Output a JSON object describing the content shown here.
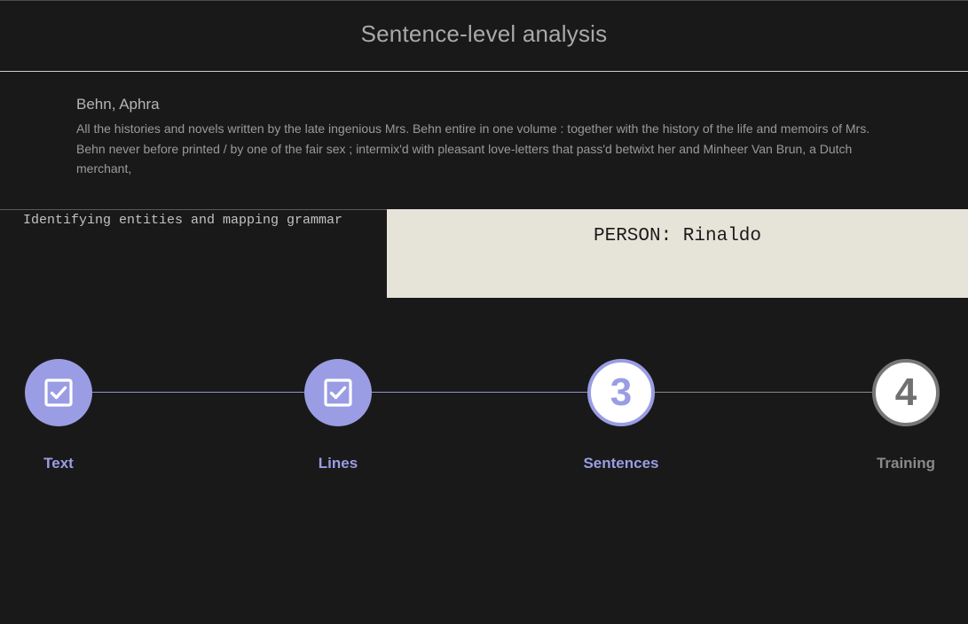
{
  "header": {
    "title": "Sentence-level analysis"
  },
  "document": {
    "author": "Behn, Aphra",
    "title": "All the histories and novels written by the late ingenious Mrs. Behn entire in one volume : together with the history of the life and memoirs of Mrs. Behn never before printed / by one of the fair sex ; intermix'd with pleasant love-letters that pass'd betwixt her and Minheer Van Brun, a Dutch merchant,"
  },
  "task": {
    "label": "Identifying entities and mapping grammar"
  },
  "entity": {
    "text": "PERSON: Rinaldo"
  },
  "stepper": {
    "steps": [
      {
        "label": "Text",
        "status": "done",
        "icon": "checkbox-checked-icon"
      },
      {
        "label": "Lines",
        "status": "done",
        "icon": "checkbox-checked-icon"
      },
      {
        "label": "Sentences",
        "status": "active",
        "number": "3"
      },
      {
        "label": "Training",
        "status": "todo",
        "number": "4"
      }
    ],
    "colors": {
      "accent": "#9a9de3",
      "inactive": "#777777"
    }
  }
}
